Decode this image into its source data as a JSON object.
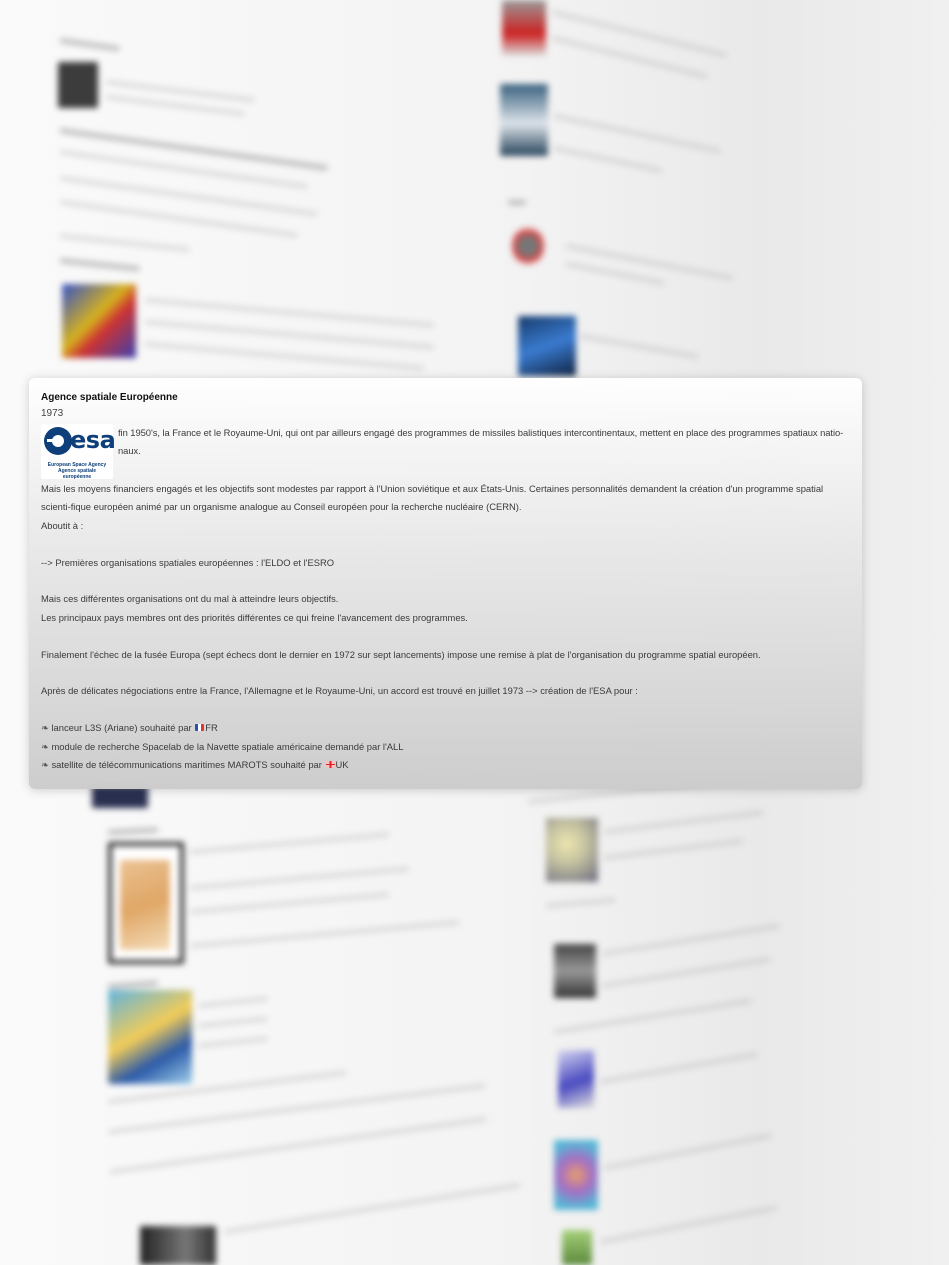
{
  "card": {
    "title": "Agence spatiale Européenne",
    "year": "1973",
    "logo": {
      "wordmark": "esa",
      "subtitle_en": "European Space Agency",
      "subtitle_fr": "Agence spatiale européenne"
    },
    "paragraphs": {
      "intro": "fin 1950's, la France et le Royaume-Uni, qui ont par ailleurs engagé des programmes de missiles balistiques intercontinentaux, mettent en place des programmes spatiaux natio-naux.",
      "means": "Mais les moyens financiers engagés et les objectifs sont modestes par rapport à l'Union soviétique et aux États-Unis. Certaines personnalités demandent la création d'un programme spatial scienti-fique européen animé par un organisme analogue au Conseil européen pour la recherche nucléaire (CERN).",
      "outcome_label": "Aboutit à :",
      "first_orgs": "--> Premières organisations spatiales européennes : l'ELDO et l'ESRO",
      "difficulty": "Mais ces différentes organisations ont du mal à atteindre leurs objectifs.",
      "priorities": "Les principaux pays membres ont des priorités différentes ce qui freine l'avancement des programmes.",
      "europa": "Finalement l'échec de la fusée Europa (sept échecs dont le dernier en 1972 sur sept lancements) impose une remise à plat de l'organisation du programme spatial européen.",
      "agreement": "Après de délicates négociations entre la France, l'Allemagne et le Royaume-Uni, un accord est trouvé en juillet 1973 --> création de l'ESA pour :"
    },
    "bullets": [
      {
        "glyph": "❧",
        "text": "lanceur L3S (Ariane) souhaité par",
        "flag": "fr-flag",
        "flag_label": "FR"
      },
      {
        "glyph": "❧",
        "text": "module de recherche Spacelab de la Navette spatiale américaine demandé par l'ALL"
      },
      {
        "glyph": "❧",
        "text": "satellite de télécommunications maritimes MAROTS souhaité par",
        "flag": "uk-flag",
        "flag_label": "UK"
      }
    ]
  }
}
